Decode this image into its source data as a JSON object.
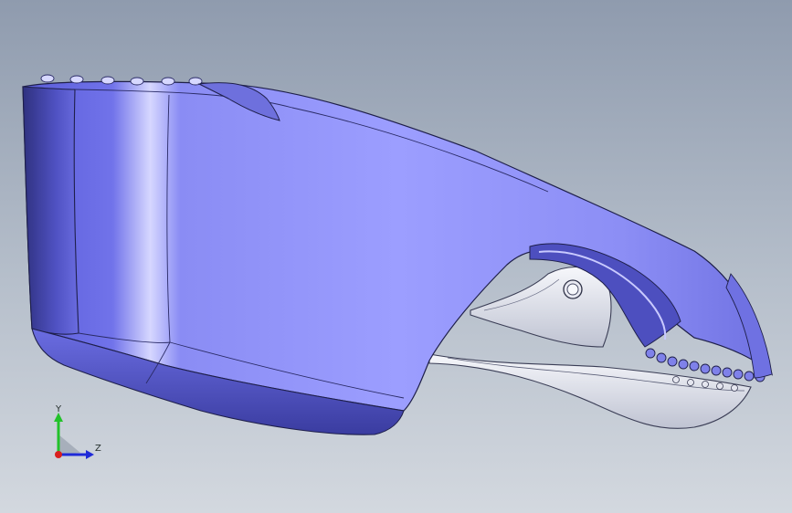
{
  "viewport": {
    "background_top": "#8f9bae",
    "background_bottom": "#d3d8df",
    "model_color": "#8a8cf2",
    "model_edge_color": "#1e1f4a",
    "metal_color": "#dfe1ea"
  },
  "triad": {
    "y_label": "Y",
    "z_label": "Z",
    "y_color": "#22c22a",
    "z_color": "#1f2ad8",
    "origin_color": "#d9201f"
  }
}
